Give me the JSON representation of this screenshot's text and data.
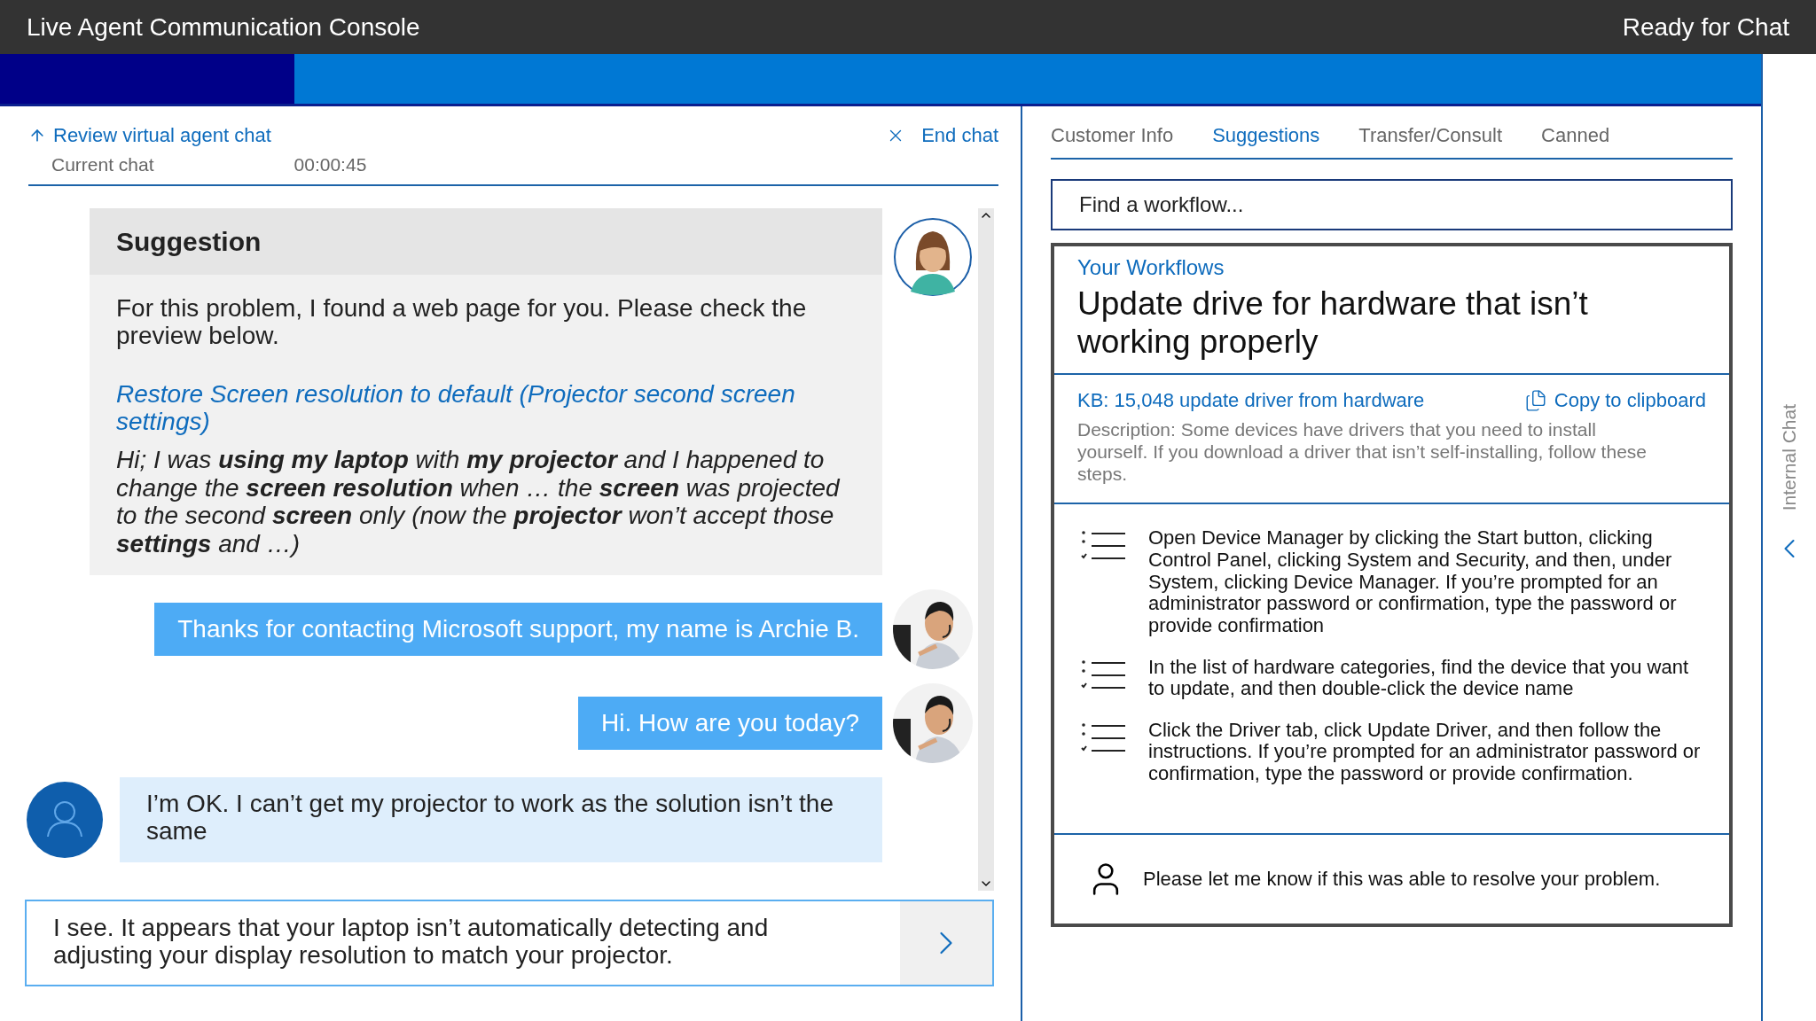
{
  "window": {
    "title": "Live Agent Communication Console",
    "status": "Ready for Chat"
  },
  "chat": {
    "back_link": "Review virtual agent chat",
    "end_chat": "End chat",
    "session_label": "Current chat",
    "timer": "00:00:45",
    "messages": [
      {
        "kind": "suggestion",
        "title": "Suggestion",
        "intro": "For this problem, I found a web page for you. Please check the preview below.",
        "link": "Restore Screen resolution to default (Projector second screen settings)",
        "excerpt": "Hi; I was **using my laptop** with **my projector** and I happened to change the **screen resolution** when … the **screen** was projected to the second **screen** only (now the **projector** won’t accept those **settings** and …)"
      },
      {
        "kind": "agent",
        "text": "Thanks for contacting Microsoft support, my name is Archie B."
      },
      {
        "kind": "agent",
        "text": "Hi. How are you today?"
      },
      {
        "kind": "customer",
        "text": "I’m OK. I can’t get my projector to work as the solution isn’t the same"
      }
    ],
    "composer": {
      "value": "I see. It appears that your laptop isn’t automatically detecting and adjusting your display resolution to match your projector."
    }
  },
  "panel": {
    "tabs": [
      {
        "label": "Customer Info",
        "selected": false
      },
      {
        "label": "Suggestions",
        "selected": true
      },
      {
        "label": "Transfer/Consult",
        "selected": false
      },
      {
        "label": "Canned",
        "selected": false
      }
    ],
    "search": {
      "placeholder": "Find a workflow..."
    },
    "workflow": {
      "section": "Your Workflows",
      "title": "Update drive for hardware that isn’t working properly",
      "kb_link": "KB: 15,048 update driver from hardware",
      "copy": "Copy to clipboard",
      "description": "Description: Some devices have drivers that you need to install yourself. If you download a driver that isn’t self-installing, follow these steps.",
      "steps": [
        "Open Device Manager by clicking the Start button, clicking Control Panel, clicking System and Security, and then, under System, clicking Device Manager. If you’re prompted for an administrator password or confirmation, type the password or provide confirmation",
        "In the list of hardware categories, find the device that you want to update, and then double-click the device name",
        "Click the Driver tab, click Update Driver, and then follow the instructions. If you’re prompted for an administrator password or confirmation, type the password or provide confirmation."
      ],
      "footer": "Please let me know if this was able to resolve your problem."
    }
  },
  "side_strip": {
    "label": "Internal Chat"
  }
}
